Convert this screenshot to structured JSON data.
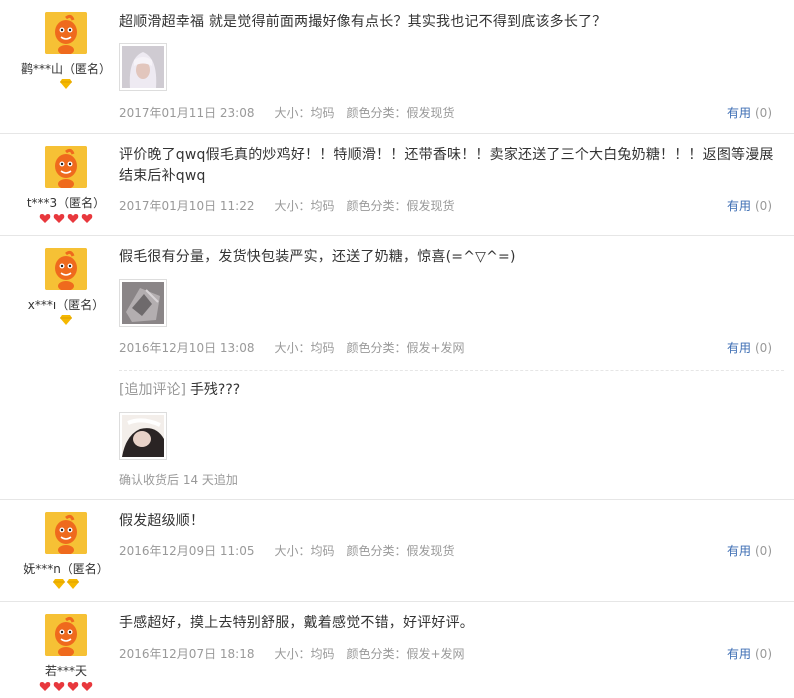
{
  "reviews": [
    {
      "user": "鹳***山（匿名）",
      "rank_icons": [
        "diamond-icon"
      ],
      "text": "超顺滑超幸福 就是觉得前面两撮好像有点长？其实我也记不得到底该多长了？",
      "date": "2017年01月11日 23:08",
      "size": "大小：均码",
      "color": "颜色分类：假发现货",
      "useful_label": "有用",
      "useful_count": "(0)"
    },
    {
      "user": "t***3（匿名）",
      "rank_icons": [
        "heart-icon",
        "heart-icon",
        "heart-icon",
        "heart-icon"
      ],
      "text": "评价晚了qwq假毛真的炒鸡好！！特顺滑！！还带香味！！卖家还送了三个大白兔奶糖！！！返图等漫展结束后补qwq",
      "date": "2017年01月10日 11:22",
      "size": "大小：均码",
      "color": "颜色分类：假发现货",
      "useful_label": "有用",
      "useful_count": "(0)"
    },
    {
      "user": "x***ı（匿名）",
      "rank_icons": [
        "diamond-icon"
      ],
      "text": "假毛很有分量，发货快包装严实，还送了奶糖，惊喜(=^▽^=)",
      "date": "2016年12月10日 13:08",
      "size": "大小：均码",
      "color": "颜色分类：假发+发网",
      "useful_label": "有用",
      "useful_count": "(0)",
      "append": {
        "tag": "[追加评论]",
        "text": "手残???",
        "note": "确认收货后 14 天追加"
      }
    },
    {
      "user": "妩***n（匿名）",
      "rank_icons": [
        "diamond-icon",
        "diamond-icon"
      ],
      "text": "假发超级顺！",
      "date": "2016年12月09日 11:05",
      "size": "大小：均码",
      "color": "颜色分类：假发现货",
      "useful_label": "有用",
      "useful_count": "(0)"
    },
    {
      "user": "若***天",
      "rank_icons": [
        "heart-icon",
        "heart-icon",
        "heart-icon",
        "heart-icon"
      ],
      "text": "手感超好，摸上去特别舒服，戴着感觉不错，好评好评。",
      "date": "2016年12月07日 18:18",
      "size": "大小：均码",
      "color": "颜色分类：假发+发网",
      "useful_label": "有用",
      "useful_count": "(0)"
    }
  ],
  "colors": {
    "link": "#3c6db3",
    "muted": "#999999",
    "avatar_bg": "#f6c135",
    "avatar_face": "#ef6a1d",
    "rank_diamond": "#f5b800",
    "rank_heart": "#e8383d"
  }
}
